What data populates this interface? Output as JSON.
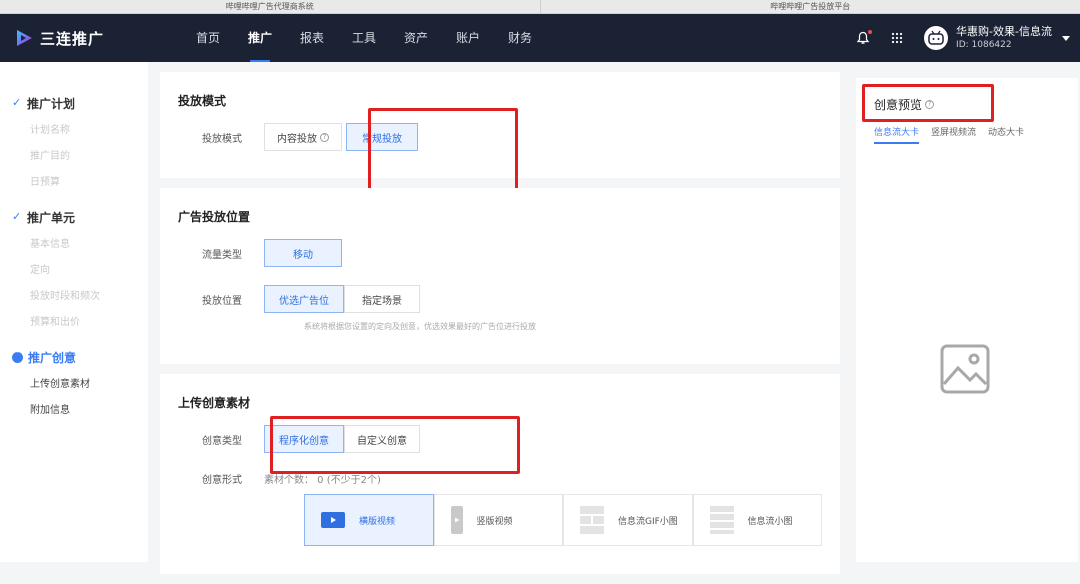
{
  "browser": {
    "tabs": [
      "哔哩哔哩广告代理商系统",
      "哔哩哔哩广告投放平台"
    ]
  },
  "topnav": {
    "brand": "三连推广",
    "items": [
      "首页",
      "推广",
      "报表",
      "工具",
      "资产",
      "账户",
      "财务"
    ],
    "active_index": 1,
    "account_name": "华惠购-效果-信息流",
    "account_id": "ID: 1086422"
  },
  "sidebar": {
    "plan": {
      "label": "推广计划",
      "subs": [
        "计划名称",
        "推广目的",
        "日预算"
      ]
    },
    "unit": {
      "label": "推广单元",
      "subs": [
        "基本信息",
        "定向",
        "投放时段和频次",
        "预算和出价"
      ]
    },
    "creative": {
      "label": "推广创意",
      "subs": [
        "上传创意素材",
        "附加信息"
      ]
    }
  },
  "delivery_mode": {
    "title": "投放模式",
    "label": "投放模式",
    "options": [
      "内容投放",
      "常规投放"
    ],
    "help": "?"
  },
  "placement": {
    "title": "广告投放位置",
    "traffic_label": "流量类型",
    "traffic_option": "移动",
    "position_label": "投放位置",
    "position_options": [
      "优选广告位",
      "指定场景"
    ],
    "hint": "系统将根据您设置的定向及创意，优选效果最好的广告位进行投放"
  },
  "upload": {
    "title": "上传创意素材",
    "type_label": "创意类型",
    "type_options": [
      "程序化创意",
      "自定义创意"
    ],
    "form_label": "创意形式",
    "material_count": "素材个数： 0   (不少于2个)",
    "formats": [
      "横版视频",
      "竖版视频",
      "信息流GIF小图",
      "信息流小图"
    ]
  },
  "preview": {
    "title": "创意预览",
    "help": "?",
    "tabs": [
      "信息流大卡",
      "竖屏视频流",
      "动态大卡"
    ]
  },
  "colors": {
    "nav_bg": "#1b2233",
    "accent": "#3b7cf4",
    "highlight_border": "#e02020"
  }
}
